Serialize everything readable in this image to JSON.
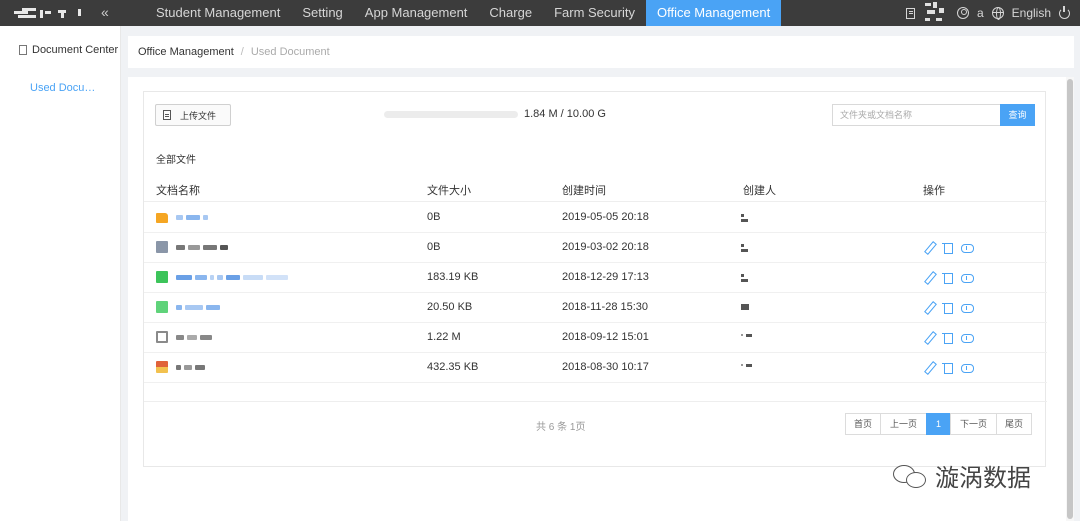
{
  "nav": {
    "menu": [
      {
        "label": "Student Management",
        "active": false
      },
      {
        "label": "Setting",
        "active": false
      },
      {
        "label": "App Management",
        "active": false
      },
      {
        "label": "Charge",
        "active": false
      },
      {
        "label": "Farm Security",
        "active": false
      },
      {
        "label": "Office Management",
        "active": true
      }
    ],
    "collapse_glyph": "«",
    "user_name": "a",
    "language": "English"
  },
  "sidebar": {
    "header": "Document Center",
    "items": [
      {
        "label": "Used Docu…",
        "active": true
      }
    ]
  },
  "breadcrumb": {
    "items": [
      "Office Management",
      "Used Document"
    ],
    "separator": "/"
  },
  "toolbar": {
    "upload_label": "上传文件",
    "storage_text": "1.84 M / 10.00 G",
    "storage_fraction": 0.0002,
    "search_placeholder": "文件夹或文档名称",
    "search_button": "查询"
  },
  "all_files_label": "全部文件",
  "table": {
    "headers": [
      "文档名称",
      "文件大小",
      "创建时间",
      "创建人",
      "操作"
    ],
    "rows": [
      {
        "icon": "folder-icon",
        "icon_color": "#f5a623",
        "size": "0B",
        "created": "2019-05-05 20:18",
        "has_ops": false
      },
      {
        "icon": "file-gray-icon",
        "icon_color": "#8a96a8",
        "size": "0B",
        "created": "2019-03-02 20:18",
        "has_ops": true
      },
      {
        "icon": "file-green-icon",
        "icon_color": "#3cc45a",
        "size": "183.19 KB",
        "created": "2018-12-29 17:13",
        "has_ops": true
      },
      {
        "icon": "file-green-icon",
        "icon_color": "#5fd37a",
        "size": "20.50 KB",
        "created": "2018-11-28 15:30",
        "has_ops": true
      },
      {
        "icon": "file-white-icon",
        "icon_color": "#9a9a9a",
        "size": "1.22 M",
        "created": "2018-09-12 15:01",
        "has_ops": true
      },
      {
        "icon": "image-file-icon",
        "icon_color": "#e0623a",
        "size": "432.35 KB",
        "created": "2018-08-30 10:17",
        "has_ops": true
      }
    ]
  },
  "pagination": {
    "total_text": "共 6 条 1页",
    "buttons": [
      "首页",
      "上一页",
      "1",
      "下一页",
      "尾页"
    ],
    "current": "1"
  },
  "watermark": {
    "text": "漩涡数据"
  },
  "colors": {
    "accent": "#4aa3f5",
    "nav_bg": "#3c3c3c"
  }
}
